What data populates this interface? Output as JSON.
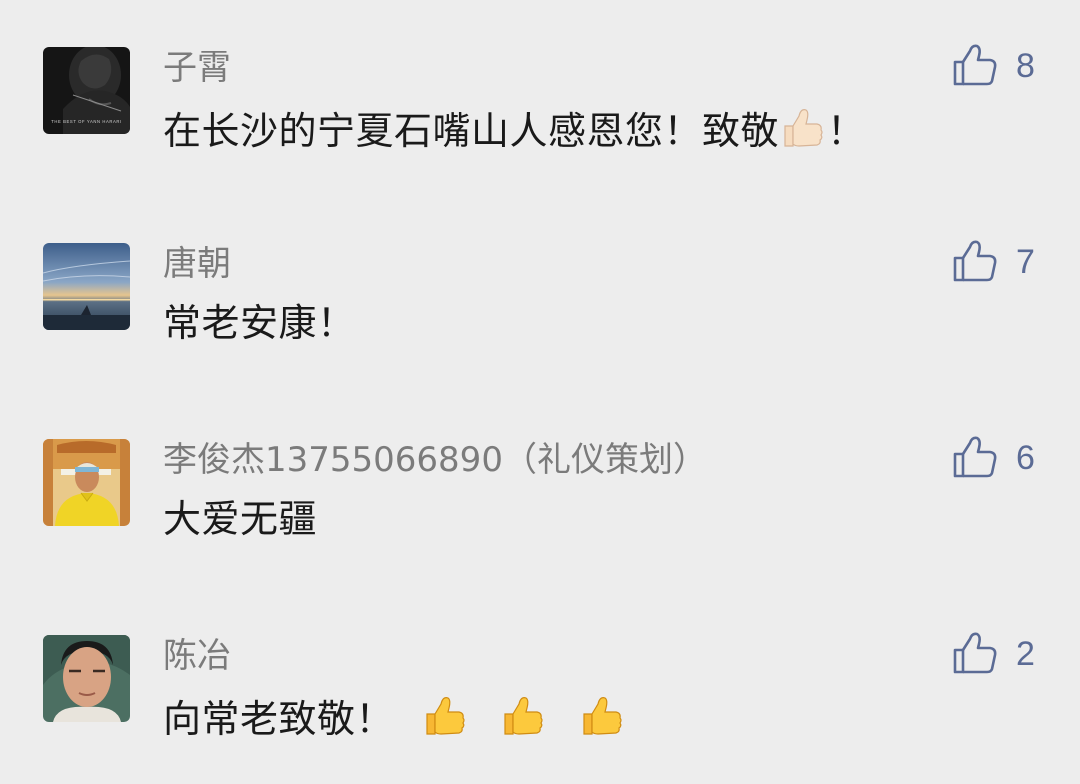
{
  "comments": [
    {
      "nickname": "子霄",
      "text": "在长沙的宁夏石嘴山人感恩您！致敬",
      "text_suffix": "！",
      "emoji_count": 1,
      "emoji_skin": "light",
      "likes": "8",
      "avatar_caption": "THE BEST OF YANN HARARI"
    },
    {
      "nickname": "唐朝",
      "text": "常老安康！",
      "text_suffix": "",
      "emoji_count": 0,
      "likes": "7"
    },
    {
      "nickname": "李俊杰13755066890（礼仪策划）",
      "text": "大爱无疆",
      "text_suffix": "",
      "emoji_count": 0,
      "likes": "6"
    },
    {
      "nickname": "陈冶",
      "text": "向常老致敬！",
      "text_suffix": "",
      "emoji_count": 3,
      "emoji_skin": "default",
      "likes": "2"
    }
  ],
  "colors": {
    "background": "#ededed",
    "nickname": "#7b7b7b",
    "content": "#1a1a1a",
    "like_accent": "#5b6b95"
  },
  "icons": {
    "like": "thumbs-up-outline-icon",
    "emoji": "thumbs-up-emoji"
  }
}
